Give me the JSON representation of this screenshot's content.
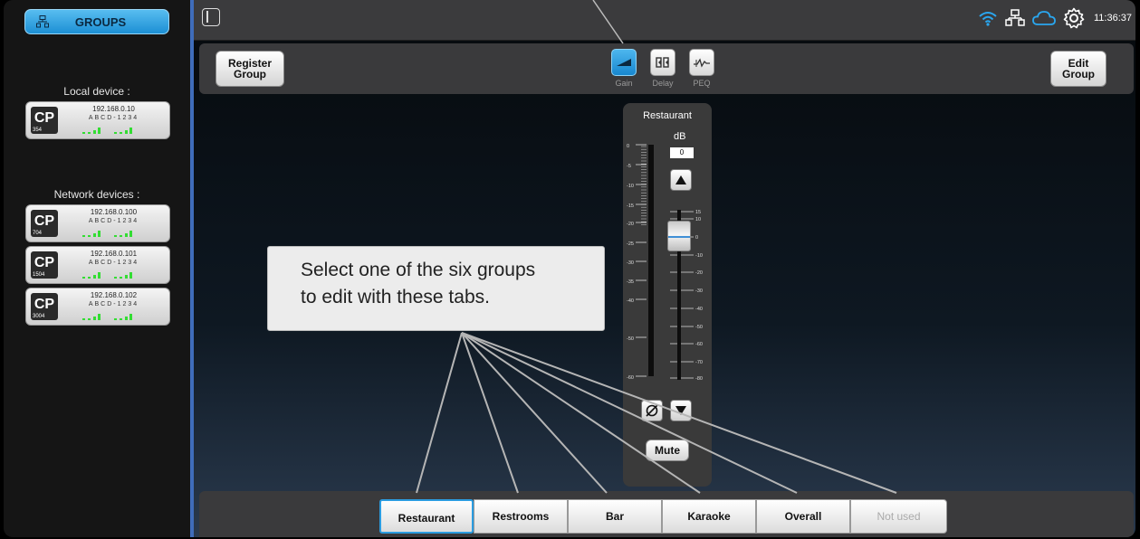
{
  "sidebar": {
    "groups_label": "GROUPS",
    "local_label": "Local device :",
    "network_label": "Network devices :",
    "local_devices": [
      {
        "ip": "192.168.0.10",
        "serial": "ABCD-1234",
        "model": "354"
      }
    ],
    "network_devices": [
      {
        "ip": "192.168.0.100",
        "serial": "ABCD-1234",
        "model": "704"
      },
      {
        "ip": "192.168.0.101",
        "serial": "ABCD-1234",
        "model": "1504"
      },
      {
        "ip": "192.168.0.102",
        "serial": "ABCD-1234",
        "model": "3004"
      }
    ],
    "logo_text": "CP"
  },
  "topbar": {
    "clock": "11:36:37",
    "icons": [
      "wifi-icon",
      "network-icon",
      "cloud-icon",
      "gear-icon"
    ]
  },
  "toolbar": {
    "register_group": "Register\nGroup",
    "edit_group": "Edit\nGroup",
    "tabs": [
      {
        "label": "Gain",
        "icon": "gain-icon",
        "active": true
      },
      {
        "label": "Delay",
        "icon": "delay-icon",
        "active": false
      },
      {
        "label": "PEQ",
        "icon": "peq-icon",
        "active": false
      }
    ]
  },
  "fader": {
    "title": "Restaurant",
    "unit": "dB",
    "value": "0",
    "left_scale": [
      "0",
      "-5",
      "-10",
      "-15",
      "-20",
      "-25",
      "-30",
      "-35",
      "-40",
      "-50",
      "-60"
    ],
    "right_scale": [
      "15",
      "10",
      "0",
      "-10",
      "-20",
      "-30",
      "-40",
      "-50",
      "-60",
      "-70",
      "-80"
    ],
    "mute_label": "Mute"
  },
  "callout": {
    "line1": "Select one of the six groups",
    "line2": "to edit with these tabs."
  },
  "group_tabs": [
    {
      "label": "Restaurant",
      "selected": true
    },
    {
      "label": "Restrooms",
      "selected": false
    },
    {
      "label": "Bar",
      "selected": false
    },
    {
      "label": "Karaoke",
      "selected": false
    },
    {
      "label": "Overall",
      "selected": false
    },
    {
      "label": "Not used",
      "selected": false,
      "disabled": true
    }
  ],
  "colors": {
    "accent": "#1c8fd4",
    "meter_green": "#33dd33",
    "divider": "#3f6dbb"
  }
}
